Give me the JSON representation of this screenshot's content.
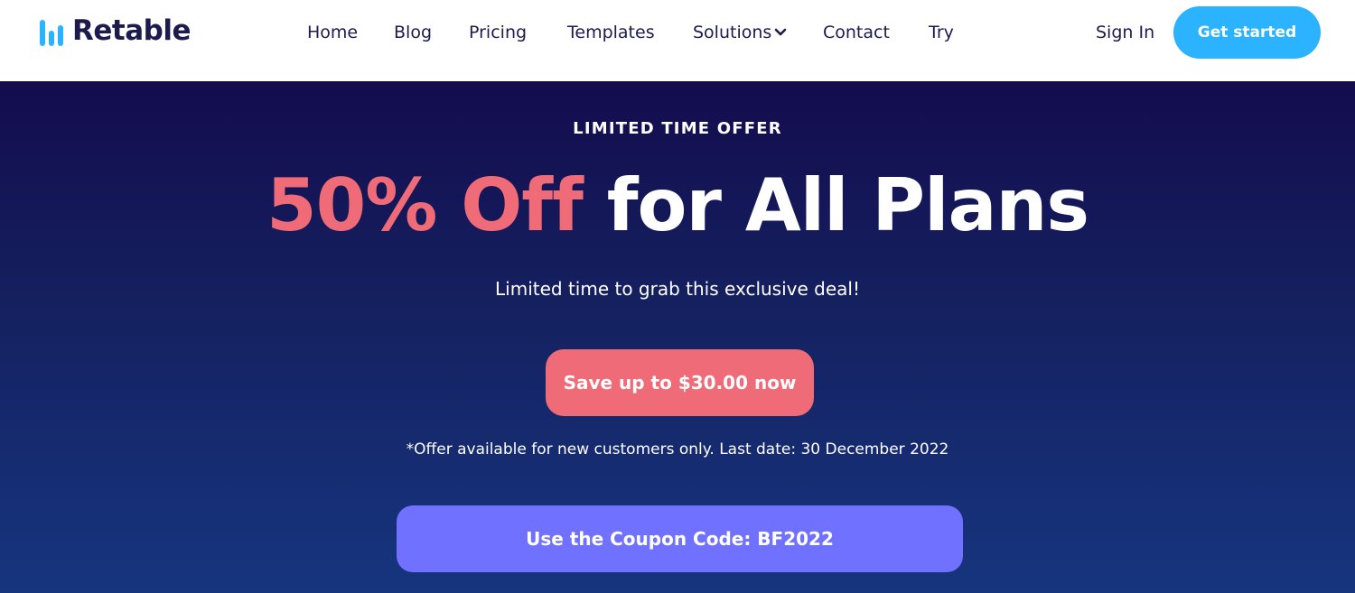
{
  "brand": {
    "name": "Retable",
    "logo_icon": "bar-chart-logo-icon",
    "colors": {
      "primary_text": "#1c1b4d",
      "accent_blue": "#2bb3ff",
      "accent_coral": "#ee6b77",
      "accent_purple": "#7171ff",
      "hero_top": "#130c4e",
      "hero_bottom": "#16357f"
    }
  },
  "nav": {
    "items": [
      {
        "label": "Home"
      },
      {
        "label": "Blog"
      },
      {
        "label": "Pricing"
      },
      {
        "label": "Templates"
      },
      {
        "label": "Solutions",
        "icon": "chevron-down-icon"
      },
      {
        "label": "Contact"
      },
      {
        "label": "Try"
      }
    ],
    "sign_in": "Sign In",
    "cta": "Get started"
  },
  "hero": {
    "eyebrow": "LIMITED TIME OFFER",
    "headline_accent": "50% Off",
    "headline_rest": "for All Plans",
    "subline": "Limited time to grab this exclusive deal!",
    "save_button": "Save up to $30.00 now",
    "note": "*Offer available for new customers only. Last date: 30 December 2022",
    "coupon_button": "Use the Coupon Code: BF2022"
  }
}
